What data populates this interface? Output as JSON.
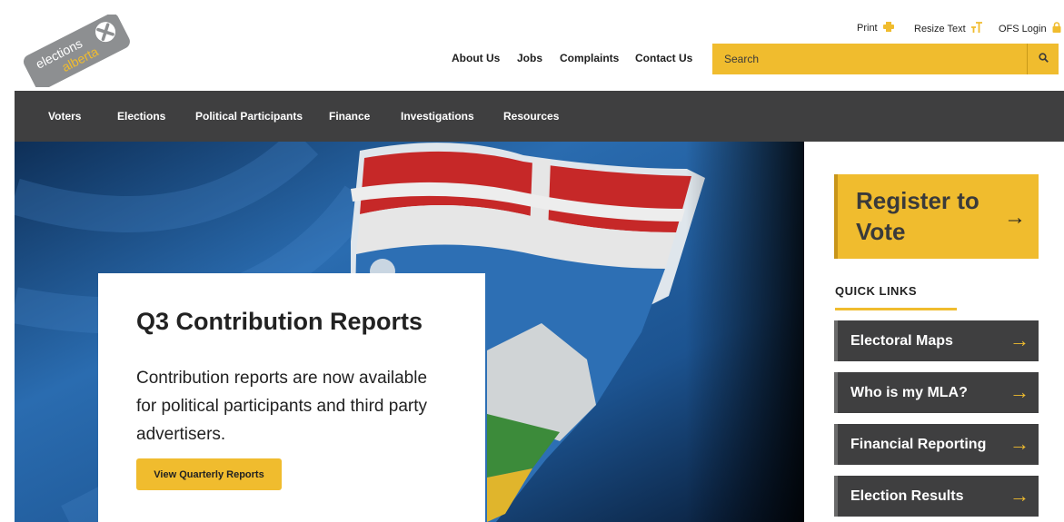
{
  "header": {
    "logo": {
      "line1": "elections",
      "line2": "alberta"
    },
    "utility": [
      {
        "label": "Print",
        "icon": "print-icon"
      },
      {
        "label": "Resize Text",
        "icon": "resize-text-icon"
      },
      {
        "label": "OFS Login",
        "icon": "lock-icon"
      }
    ],
    "nav": [
      "About Us",
      "Jobs",
      "Complaints",
      "Contact Us"
    ],
    "search": {
      "placeholder": "Search",
      "icon": "search-icon"
    }
  },
  "section_nav": [
    "Voters",
    "Elections",
    "Political Participants",
    "Finance",
    "Investigations",
    "Resources"
  ],
  "hero": {
    "title": "Q3 Contribution Reports",
    "body": "Contribution reports are now available for political participants and third party advertisers.",
    "button": "View Quarterly Reports"
  },
  "sidebar": {
    "register": {
      "label": "Register to Vote",
      "arrow": "→"
    },
    "quick_links_title": "QUICK LINKS",
    "quick_links": [
      {
        "label": "Electoral Maps",
        "arrow": "→"
      },
      {
        "label": "Who is my MLA?",
        "arrow": "→"
      },
      {
        "label": "Financial Reporting",
        "arrow": "→"
      },
      {
        "label": "Election Results",
        "arrow": "→"
      }
    ]
  },
  "colors": {
    "accent": "#f0bc2e",
    "nav_bg": "#3f3f40",
    "hero_blue": "#1f5c99"
  }
}
